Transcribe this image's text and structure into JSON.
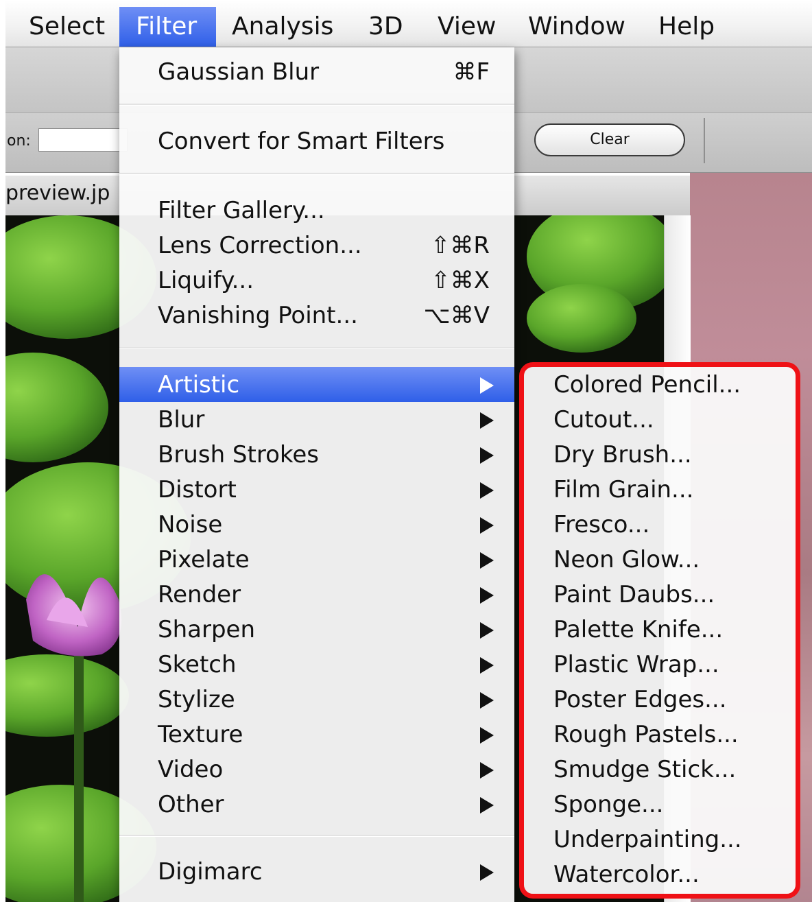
{
  "menubar": {
    "items": [
      {
        "label": "Select"
      },
      {
        "label": "Filter"
      },
      {
        "label": "Analysis"
      },
      {
        "label": "3D"
      },
      {
        "label": "View"
      },
      {
        "label": "Window"
      },
      {
        "label": "Help"
      }
    ]
  },
  "options_bar": {
    "field_label": "on:",
    "clear_label": "Clear"
  },
  "document": {
    "title": "preview.jp"
  },
  "filter_menu": {
    "top_items": [
      {
        "label": "Gaussian Blur",
        "shortcut": "⌘F"
      },
      {
        "label": "Convert for Smart Filters",
        "shortcut": ""
      },
      {
        "label": "Filter Gallery...",
        "shortcut": ""
      },
      {
        "label": "Lens Correction...",
        "shortcut": "⇧⌘R"
      },
      {
        "label": "Liquify...",
        "shortcut": "⇧⌘X"
      },
      {
        "label": "Vanishing Point...",
        "shortcut": "⌥⌘V"
      }
    ],
    "submenus": [
      {
        "label": "Artistic"
      },
      {
        "label": "Blur"
      },
      {
        "label": "Brush Strokes"
      },
      {
        "label": "Distort"
      },
      {
        "label": "Noise"
      },
      {
        "label": "Pixelate"
      },
      {
        "label": "Render"
      },
      {
        "label": "Sharpen"
      },
      {
        "label": "Sketch"
      },
      {
        "label": "Stylize"
      },
      {
        "label": "Texture"
      },
      {
        "label": "Video"
      },
      {
        "label": "Other"
      }
    ],
    "bottom_items": [
      {
        "label": "Digimarc"
      }
    ]
  },
  "artistic_submenu": {
    "items": [
      "Colored Pencil...",
      "Cutout...",
      "Dry Brush...",
      "Film Grain...",
      "Fresco...",
      "Neon Glow...",
      "Paint Daubs...",
      "Palette Knife...",
      "Plastic Wrap...",
      "Poster Edges...",
      "Rough Pastels...",
      "Smudge Stick...",
      "Sponge...",
      "Underpainting...",
      "Watercolor..."
    ]
  },
  "colors": {
    "highlight": "#3366ee",
    "callout_border": "#ef1116"
  }
}
